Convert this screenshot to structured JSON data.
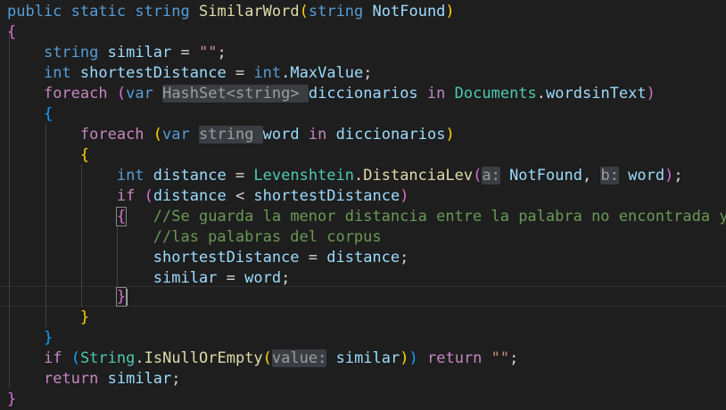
{
  "editor": {
    "line1": {
      "kw_public": "public",
      "kw_static": "static",
      "kw_string": "string",
      "method_name": "SimilarWord",
      "open_paren": "(",
      "param_type": "string",
      "param_name": "NotFound",
      "close_paren": ")"
    },
    "line2": {
      "brace": "{"
    },
    "line3": {
      "type": "string",
      "name": "similar",
      "op": " = ",
      "value": "\"\"",
      "semi": ";"
    },
    "line4": {
      "type": "int",
      "name": "shortestDistance",
      "op": " = ",
      "owner": "int",
      "dot": ".",
      "member": "MaxValue",
      "semi": ";"
    },
    "line5": {
      "kw_foreach": "foreach",
      "open_paren": "(",
      "kw_var": "var",
      "type_hint": "HashSet<string> ",
      "name": "diccionarios",
      "kw_in": "in",
      "source_class": "Documents",
      "dot": ".",
      "source_member": "wordsinText",
      "close_paren": ")"
    },
    "line6": {
      "brace": "{"
    },
    "line7": {
      "kw_foreach": "foreach",
      "open_paren": "(",
      "kw_var": "var",
      "type_hint": "string ",
      "name": "word",
      "kw_in": "in",
      "source": "diccionarios",
      "close_paren": ")"
    },
    "line8": {
      "brace": "{"
    },
    "line9": {
      "type": "int",
      "name": "distance",
      "op": " = ",
      "class_name": "Levenshtein",
      "dot": ".",
      "method": "DistanciaLev",
      "open_paren": "(",
      "hint_a": "a:",
      "arg_a": "NotFound",
      "comma": ", ",
      "hint_b": "b:",
      "arg_b": "word",
      "close_paren": ")",
      "semi": ";"
    },
    "line10": {
      "kw_if": "if",
      "open_paren": "(",
      "left": "distance",
      "op": " < ",
      "right": "shortestDistance",
      "close_paren": ")"
    },
    "line11": {
      "brace": "{",
      "comment": "//Se guarda la menor distancia entre la palabra no encontrada y"
    },
    "line12": {
      "comment": "//las palabras del corpus"
    },
    "line13": {
      "name": "shortestDistance",
      "op": " = ",
      "value": "distance",
      "semi": ";"
    },
    "line14": {
      "name": "similar",
      "op": " = ",
      "value": "word",
      "semi": ";"
    },
    "line15": {
      "brace": "}"
    },
    "line16": {
      "brace": "}"
    },
    "line17": {
      "brace": "}"
    },
    "line18": {
      "kw_if": "if",
      "open_paren": "(",
      "class_name": "String",
      "dot": ".",
      "method": "IsNullOrEmpty",
      "inner_open": "(",
      "hint_value": "value:",
      "arg": "similar",
      "inner_close": ")",
      "close_paren": ")",
      "kw_return": "return",
      "value": "\"\"",
      "semi": ";"
    },
    "line19": {
      "kw_return": "return",
      "name": "similar",
      "semi": ";"
    },
    "line20": {
      "brace": "}"
    }
  },
  "colors": {
    "background": "#1e1e1e",
    "keyword": "#569cd6",
    "control": "#c586c0",
    "type": "#4ec9b0",
    "method": "#dcdcaa",
    "variable": "#9cdcfe",
    "string": "#ce9178",
    "comment": "#6a9955",
    "bracket_1": "#ffd700",
    "bracket_2": "#da70d6",
    "bracket_3": "#179fff"
  }
}
